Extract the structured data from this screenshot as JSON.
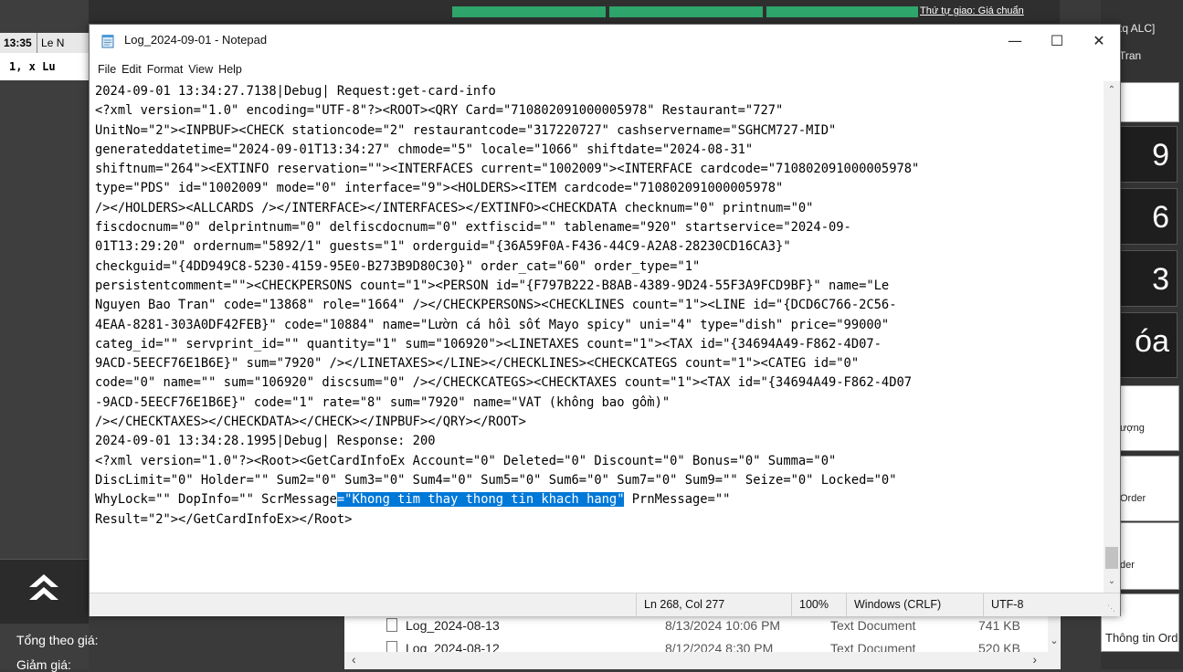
{
  "background": {
    "time": "13:35",
    "user_abbrev": "Le N",
    "row2": "1,  x Lu",
    "top_right_label": "Thứ tự giao: Giá chuẩn",
    "right_head_line1": "tq  ALC]",
    "right_head_line2": "Tran",
    "right_buttons": [
      "9",
      "6",
      "3",
      "óa"
    ],
    "right_small_buttons": [
      "ượng",
      "Order",
      "der"
    ],
    "right_order_info": "Thông tin Order",
    "left_total_label": "Tổng theo giá:",
    "left_discount_label": "Giảm giá:"
  },
  "explorer": {
    "rows": [
      {
        "name": "Log_2024-08-13",
        "date": "8/13/2024 10:06 PM",
        "type": "Text Document",
        "size": "741 KB"
      },
      {
        "name": "Log_2024-08-12",
        "date": "8/12/2024 8:30 PM",
        "type": "Text Document",
        "size": "520 KB"
      }
    ]
  },
  "notepad": {
    "title": "Log_2024-09-01 - Notepad",
    "menu": [
      "File",
      "Edit",
      "Format",
      "View",
      "Help"
    ],
    "lines": [
      "2024-09-01 13:34:27.7138|Debug| Request:get-card-info",
      "<?xml version=\"1.0\" encoding=\"UTF-8\"?><ROOT><QRY Card=\"710802091000005978\" Restaurant=\"727\"",
      "UnitNo=\"2\"><INPBUF><CHECK stationcode=\"2\" restaurantcode=\"317220727\" cashservername=\"SGHCM727-MID\"",
      "generateddatetime=\"2024-09-01T13:34:27\" chmode=\"5\" locale=\"1066\" shiftdate=\"2024-08-31\"",
      "shiftnum=\"264\"><EXTINFO reservation=\"\"><INTERFACES current=\"1002009\"><INTERFACE cardcode=\"710802091000005978\"",
      "type=\"PDS\" id=\"1002009\" mode=\"0\" interface=\"9\"><HOLDERS><ITEM cardcode=\"710802091000005978\"",
      "/></HOLDERS><ALLCARDS /></INTERFACE></INTERFACES></EXTINFO><CHECKDATA checknum=\"0\" printnum=\"0\"",
      "fiscdocnum=\"0\" delprintnum=\"0\" delfiscdocnum=\"0\" extfiscid=\"\" tablename=\"920\" startservice=\"2024-09-",
      "01T13:29:20\" ordernum=\"5892/1\" guests=\"1\" orderguid=\"{36A59F0A-F436-44C9-A2A8-28230CD16CA3}\"",
      "checkguid=\"{4DD949C8-5230-4159-95E0-B273B9D80C30}\" order_cat=\"60\" order_type=\"1\"",
      "persistentcomment=\"\"><CHECKPERSONS count=\"1\"><PERSON id=\"{F797B222-B8AB-4389-9D24-55F3A9FCD9BF}\" name=\"Le",
      "Nguyen Bao Tran\" code=\"13868\" role=\"1664\" /></CHECKPERSONS><CHECKLINES count=\"1\"><LINE id=\"{DCD6C766-2C56-",
      "4EAA-8281-303A0DF42FEB}\" code=\"10884\" name=\"Lườn cá hồi sốt Mayo spicy\" uni=\"4\" type=\"dish\" price=\"99000\"",
      "categ_id=\"\" servprint_id=\"\" quantity=\"1\" sum=\"106920\"><LINETAXES count=\"1\"><TAX id=\"{34694A49-F862-4D07-",
      "9ACD-5EECF76E1B6E}\" sum=\"7920\" /></LINETAXES></LINE></CHECKLINES><CHECKCATEGS count=\"1\"><CATEG id=\"0\"",
      "code=\"0\" name=\"\" sum=\"106920\" discsum=\"0\" /></CHECKCATEGS><CHECKTAXES count=\"1\"><TAX id=\"{34694A49-F862-4D07",
      "-9ACD-5EECF76E1B6E}\" code=\"1\" rate=\"8\" sum=\"7920\" name=\"VAT (không bao gồm)\"",
      "/></CHECKTAXES></CHECKDATA></CHECK></INPBUF></QRY></ROOT>",
      "2024-09-01 13:34:28.1995|Debug| Response: 200",
      "<?xml version=\"1.0\"?><Root><GetCardInfoEx Account=\"0\" Deleted=\"0\" Discount=\"0\" Bonus=\"0\" Summa=\"0\"",
      "DiscLimit=\"0\" Holder=\"\" Sum2=\"0\" Sum3=\"0\" Sum4=\"0\" Sum5=\"0\" Sum6=\"0\" Sum7=\"0\" Sum9=\"\" Seize=\"0\" Locked=\"0\""
    ],
    "selection_line": {
      "before": "WhyLock=\"\" DopInfo=\"\" ScrMessage",
      "selected": "=\"Khong tim thay thong tin khach hang\"",
      "after": " PrnMessage=\"\""
    },
    "last_line": "Result=\"2\"></GetCardInfoEx></Root>",
    "status": {
      "position": "Ln 268, Col 277",
      "zoom": "100%",
      "line_ending": "Windows (CRLF)",
      "encoding": "UTF-8"
    },
    "accent_color": "#0078d7"
  }
}
